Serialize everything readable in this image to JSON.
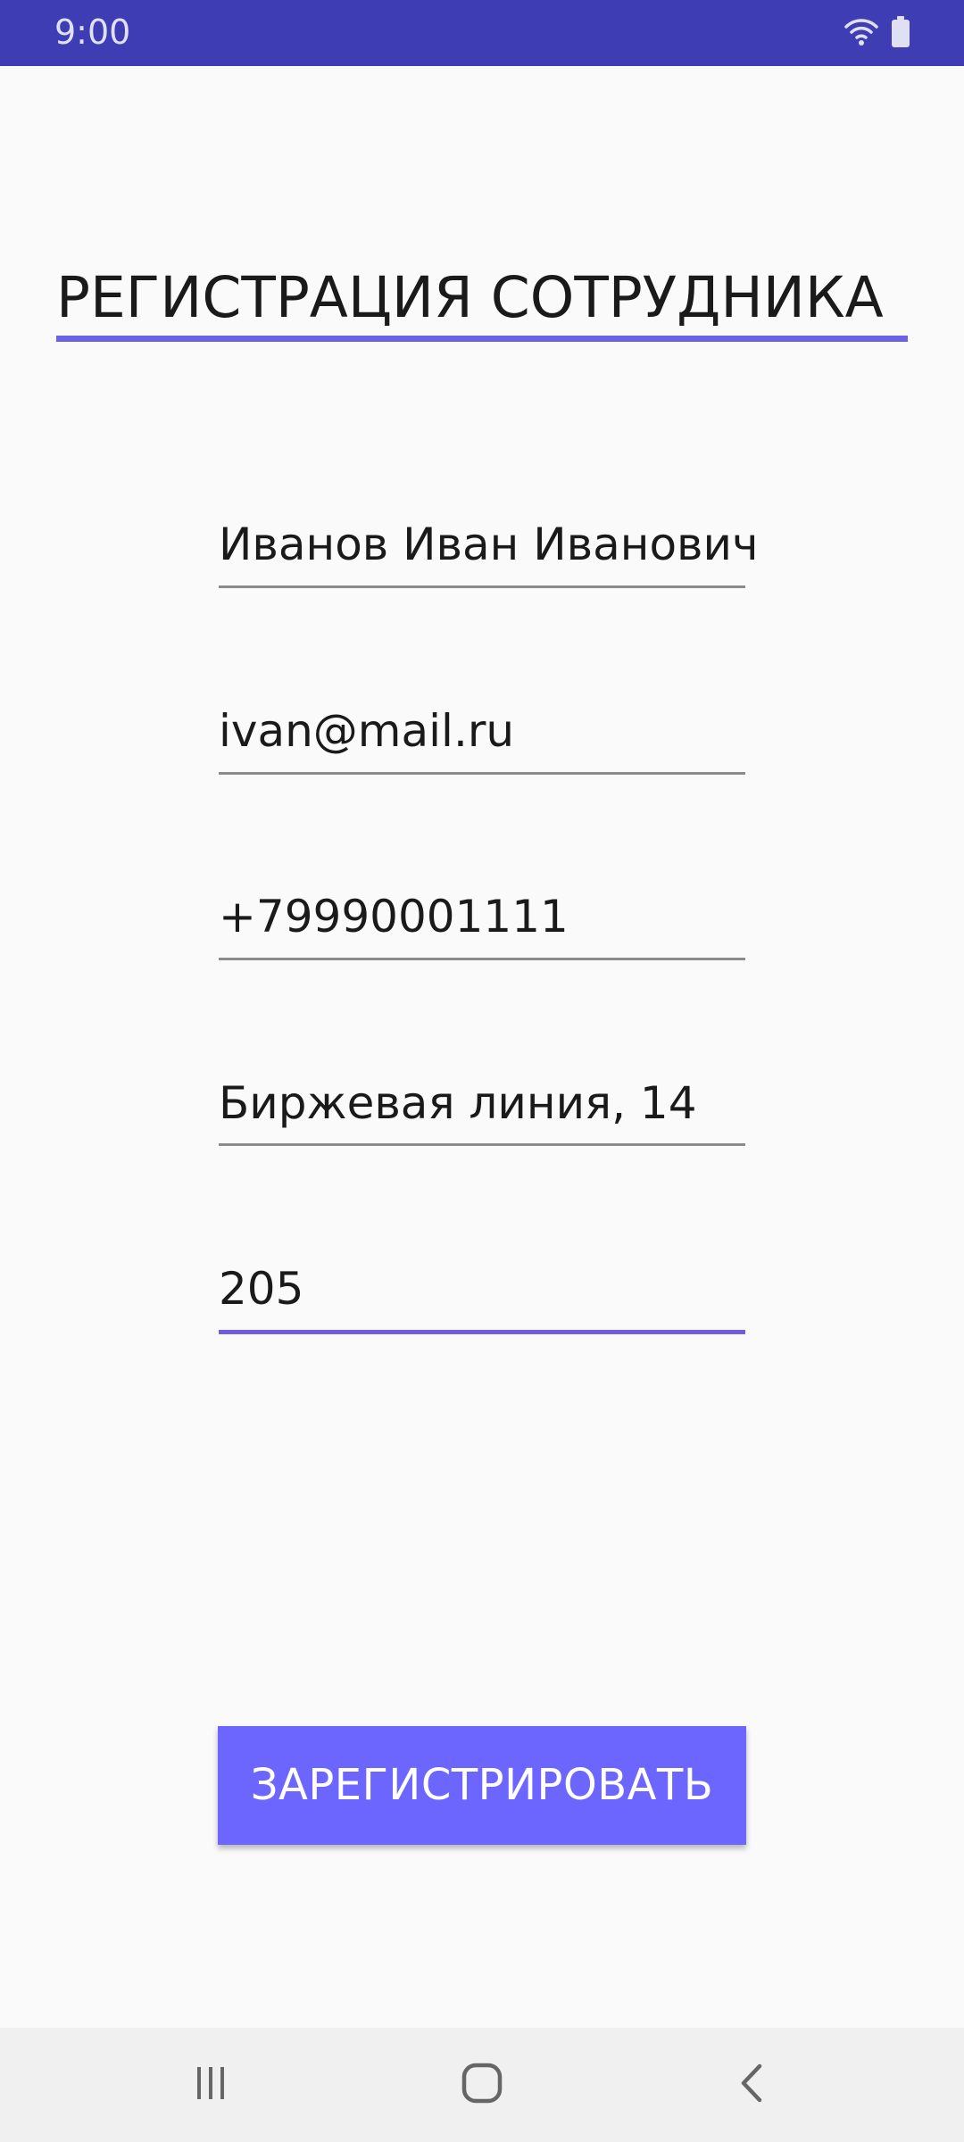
{
  "status_bar": {
    "time": "9:00",
    "icons": [
      "wifi-icon",
      "battery-icon"
    ],
    "background": "#3f3db3"
  },
  "screen": {
    "title": "РЕГИСТРАЦИЯ СОТРУДНИКА",
    "accent": "#6b63e6"
  },
  "form": {
    "fields": [
      {
        "name": "full_name",
        "value": "Иванов Иван Иванович"
      },
      {
        "name": "email",
        "value": "ivan@mail.ru"
      },
      {
        "name": "phone",
        "value": "+79990001111"
      },
      {
        "name": "address",
        "value": "Биржевая линия, 14"
      },
      {
        "name": "room",
        "value": "205",
        "focused": true
      }
    ],
    "submit_label": "ЗАРЕГИСТРИРОВАТЬ",
    "button_color": "#6c66ff"
  },
  "nav_bar": {
    "buttons": [
      "recent-apps-icon",
      "home-icon",
      "back-icon"
    ]
  }
}
